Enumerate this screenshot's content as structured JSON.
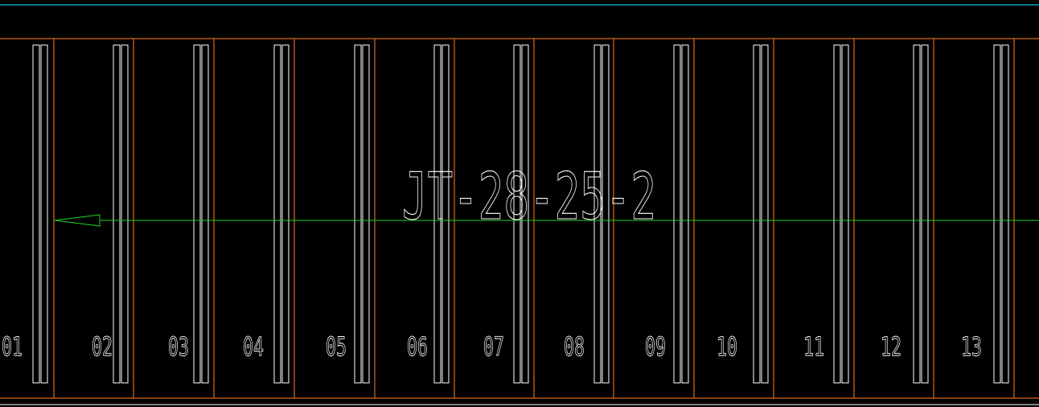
{
  "drawing": {
    "label": "JT-28-25-2",
    "bay_numbers": [
      "01",
      "02",
      "03",
      "04",
      "05",
      "06",
      "07",
      "08",
      "09",
      "10",
      "11",
      "12",
      "13"
    ]
  },
  "colors": {
    "background": "#000000",
    "top_boundary": "#00c8e0",
    "grid_orange": "#d86a1c",
    "bar_white": "#ffffff",
    "centerline_green": "#1fd21f",
    "bottom_boundary": "#ffffff"
  }
}
